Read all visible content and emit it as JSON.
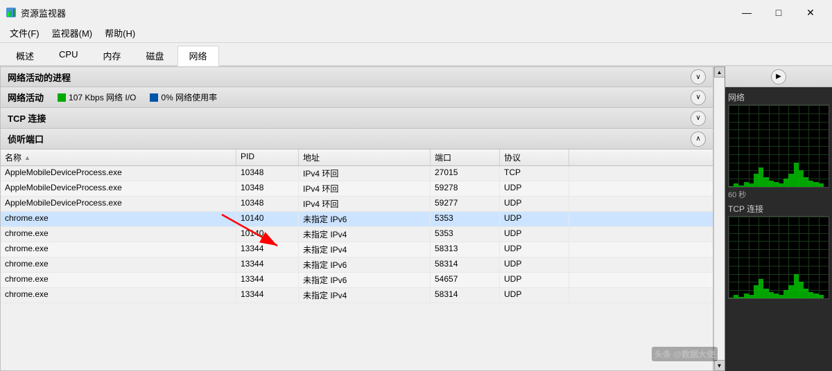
{
  "titlebar": {
    "title": "资源监视器",
    "min_label": "—",
    "max_label": "□",
    "close_label": "✕"
  },
  "menubar": {
    "items": [
      {
        "label": "文件(F)"
      },
      {
        "label": "监视器(M)"
      },
      {
        "label": "帮助(H)"
      }
    ]
  },
  "tabs": [
    {
      "label": "概述"
    },
    {
      "label": "CPU"
    },
    {
      "label": "内存"
    },
    {
      "label": "磁盘"
    },
    {
      "label": "网络",
      "active": true
    }
  ],
  "sections": {
    "network_processes": {
      "title": "网络活动的进程",
      "chevron": "∨"
    },
    "network_activity": {
      "title": "网络活动",
      "io_label": "107 Kbps 网络 I/O",
      "usage_label": "0% 网络使用率",
      "chevron": "∨"
    },
    "tcp_connections": {
      "title": "TCP 连接",
      "chevron": "∨"
    },
    "listening_ports": {
      "title": "侦听端口",
      "chevron": "∧"
    }
  },
  "table": {
    "columns": {
      "name": "名称",
      "pid": "PID",
      "address": "地址",
      "port": "端口",
      "protocol": "协议"
    },
    "rows": [
      {
        "name": "AppleMobileDeviceProcess.exe",
        "pid": "10348",
        "address": "IPv4 环回",
        "port": "27015",
        "protocol": "TCP",
        "highlighted": false
      },
      {
        "name": "AppleMobileDeviceProcess.exe",
        "pid": "10348",
        "address": "IPv4 环回",
        "port": "59278",
        "protocol": "UDP",
        "highlighted": false
      },
      {
        "name": "AppleMobileDeviceProcess.exe",
        "pid": "10348",
        "address": "IPv4 环回",
        "port": "59277",
        "protocol": "UDP",
        "highlighted": false
      },
      {
        "name": "chrome.exe",
        "pid": "10140",
        "address": "未指定 IPv6",
        "port": "5353",
        "protocol": "UDP",
        "highlighted": true
      },
      {
        "name": "chrome.exe",
        "pid": "10140",
        "address": "未指定 IPv4",
        "port": "5353",
        "protocol": "UDP",
        "highlighted": false
      },
      {
        "name": "chrome.exe",
        "pid": "13344",
        "address": "未指定 IPv4",
        "port": "58313",
        "protocol": "UDP",
        "highlighted": false
      },
      {
        "name": "chrome.exe",
        "pid": "13344",
        "address": "未指定 IPv6",
        "port": "58314",
        "protocol": "UDP",
        "highlighted": false
      },
      {
        "name": "chrome.exe",
        "pid": "13344",
        "address": "未指定 IPv6",
        "port": "54657",
        "protocol": "UDP",
        "highlighted": false
      },
      {
        "name": "chrome.exe",
        "pid": "13344",
        "address": "未指定 IPv4",
        "port": "58314",
        "protocol": "UDP",
        "highlighted": false
      }
    ]
  },
  "right_panel": {
    "expand_label": "▶",
    "network_label": "网络",
    "time_label": "60 秒",
    "tcp_label": "TCP 连接"
  },
  "watermark": "头条 @数据大使"
}
